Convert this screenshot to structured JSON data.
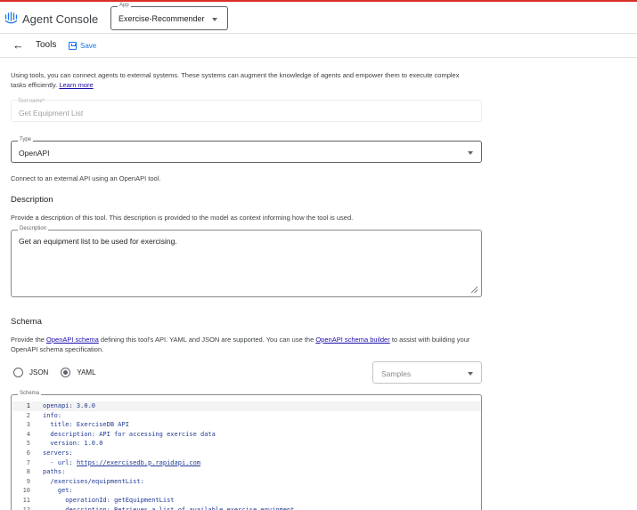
{
  "header": {
    "brand": "Agent Console",
    "app_selector_label": "App",
    "app_selector_value": "Exercise-Recommender"
  },
  "toolbar": {
    "title": "Tools",
    "save_label": "Save"
  },
  "intro": {
    "text": "Using tools, you can connect agents to external systems. These systems can augment the knowledge of agents and empower them to execute complex tasks efficiently.",
    "link": "Learn more"
  },
  "tool_name": {
    "label": "Tool name*",
    "value": "Get Equipment List"
  },
  "type": {
    "label": "Type",
    "value": "OpenAPI",
    "hint": "Connect to an external API using an OpenAPI tool."
  },
  "description": {
    "heading": "Description",
    "help": "Provide a description of this tool. This description is provided to the model as context informing how the tool is used.",
    "field_label": "Description",
    "value": "Get an equipment list to be used for exercising."
  },
  "schema": {
    "heading": "Schema",
    "help_pre": "Provide the ",
    "help_link1": "OpenAPI schema",
    "help_mid": " defining this tool's API. YAML and JSON are supported. You can use the ",
    "help_link2": "OpenAPI schema builder",
    "help_post": " to assist with building your OpenAPI schema specification.",
    "format_options": [
      "JSON",
      "YAML"
    ],
    "selected_format": "YAML",
    "samples_placeholder": "Samples",
    "field_label": "Schema",
    "code_lines": [
      {
        "n": "1",
        "text": "openapi: 3.0.0"
      },
      {
        "n": "2",
        "text": "info:"
      },
      {
        "n": "3",
        "text": "  title: ExerciseDB API"
      },
      {
        "n": "4",
        "text": "  description: API for accessing exercise data"
      },
      {
        "n": "5",
        "text": "  version: 1.0.0"
      },
      {
        "n": "6",
        "text": "servers:"
      },
      {
        "n": "7",
        "text": "  - url: ",
        "url": "https://exercisedb.p.rapidapi.com"
      },
      {
        "n": "8",
        "text": "paths:"
      },
      {
        "n": "9",
        "text": "  /exercises/equipmentList:"
      },
      {
        "n": "10",
        "text": "    get:"
      },
      {
        "n": "11",
        "text": "      operationId: getEquipmentList"
      },
      {
        "n": "12",
        "text": "      description: Retrieves a list of available exercise equipment."
      }
    ]
  },
  "colors": {
    "accent": "#1a73e8",
    "top_bar": "#d93025",
    "code_text": "#1f3a93"
  }
}
